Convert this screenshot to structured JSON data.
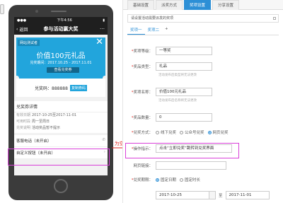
{
  "phone": {
    "status_time": "下午4:56",
    "status_right": "●●●",
    "back_label": "返回",
    "nav_title": "参与活动赢大奖",
    "more_label": "…",
    "shop_name": "网站测试者",
    "close_glyph": "✕",
    "prize_text": "价值100元礼品",
    "valid_period": "兑奖期间：2017.10.25 - 2017.11.01",
    "use_button": "查看兑奖券",
    "code_label": "兑奖码：888888",
    "copy_button": "复制券码",
    "detail_header": "兑奖券详情",
    "detail_rows": [
      {
        "k": "有效日期",
        "v": "2017-10-25至2017-11-01"
      },
      {
        "k": "可用时段",
        "v": "周一至周日"
      },
      {
        "k": "兑奖说明",
        "v": "活动奖品暂不提示"
      }
    ],
    "info_rows": [
      {
        "label": "客服电话（未开启）",
        "icon": "✆"
      },
      {
        "label": "自定义按钮（未开启）",
        "icon": "›"
      }
    ]
  },
  "annotation": {
    "label": "为空时",
    "color": "#e0251f",
    "highlight_color": "#d940d9"
  },
  "settings": {
    "tabs": [
      {
        "label": "基础设置",
        "active": false
      },
      {
        "label": "派奖方式",
        "active": false
      },
      {
        "label": "奖项设置",
        "active": true
      },
      {
        "label": "分享设置",
        "active": false
      }
    ],
    "notice": "请设置活动需要派发的奖项",
    "subtabs": [
      "奖项一",
      "奖项二",
      "+"
    ],
    "fields": {
      "level_label": "奖项等级：",
      "level_value": "一等奖",
      "type_label": "奖品类型：",
      "type_value": "礼品",
      "type_hint": "活动发布后类型将无法更改",
      "name_label": "奖项名称：",
      "name_value": "价值100元礼品",
      "name_hint": "活动发布后名称将无法更改",
      "qty_label": "奖品数量：",
      "qty_value": "0",
      "redeem_label": "兑奖方式：",
      "redeem_options": [
        "线下兑奖",
        "公众号兑奖",
        "网页兑奖"
      ],
      "op_label": "操作指示：",
      "op_value": "点击“立即兑奖”跳转到兑奖界面",
      "web_label": "网页链接：",
      "web_value": "",
      "period_label": "兑奖期限：",
      "period_options": [
        "固定日期",
        "固定时长"
      ],
      "date_start": "2017-10-25",
      "date_to": "至",
      "date_end": "2017-11-01"
    },
    "accent": "#2c8fd6"
  }
}
